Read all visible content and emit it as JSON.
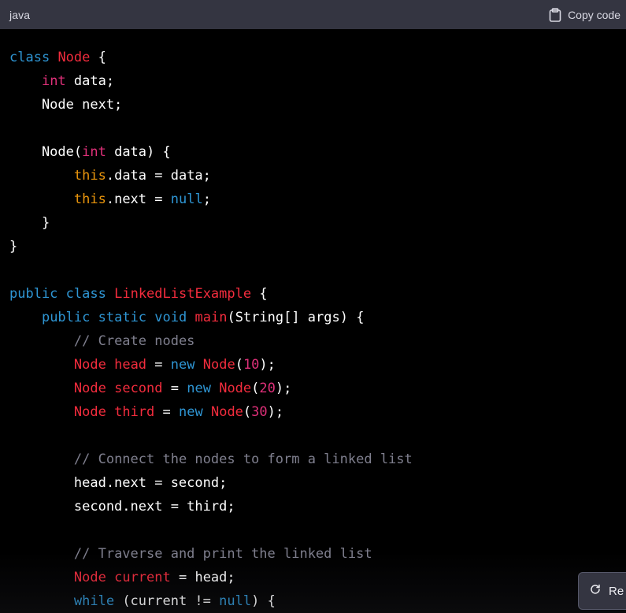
{
  "header": {
    "language": "java",
    "copy_label": "Copy code"
  },
  "code_lines": [
    [
      [
        "class",
        "kw"
      ],
      [
        " ",
        "txt"
      ],
      [
        "Node",
        "cls"
      ],
      [
        " {",
        "txt"
      ]
    ],
    [
      [
        "    ",
        "txt"
      ],
      [
        "int",
        "type"
      ],
      [
        " data;",
        "txt"
      ]
    ],
    [
      [
        "    Node next;",
        "txt"
      ]
    ],
    [
      [
        "",
        "txt"
      ]
    ],
    [
      [
        "    Node(",
        "txt"
      ],
      [
        "int",
        "type"
      ],
      [
        " data) {",
        "txt"
      ]
    ],
    [
      [
        "        ",
        "txt"
      ],
      [
        "this",
        "this"
      ],
      [
        ".data = data;",
        "txt"
      ]
    ],
    [
      [
        "        ",
        "txt"
      ],
      [
        "this",
        "this"
      ],
      [
        ".next = ",
        "txt"
      ],
      [
        "null",
        "lit"
      ],
      [
        ";",
        "txt"
      ]
    ],
    [
      [
        "    }",
        "txt"
      ]
    ],
    [
      [
        "}",
        "txt"
      ]
    ],
    [
      [
        "",
        "txt"
      ]
    ],
    [
      [
        "public",
        "kw"
      ],
      [
        " ",
        "txt"
      ],
      [
        "class",
        "kw"
      ],
      [
        " ",
        "txt"
      ],
      [
        "LinkedListExample",
        "cls"
      ],
      [
        " {",
        "txt"
      ]
    ],
    [
      [
        "    ",
        "txt"
      ],
      [
        "public",
        "kw"
      ],
      [
        " ",
        "txt"
      ],
      [
        "static",
        "kw"
      ],
      [
        " ",
        "txt"
      ],
      [
        "void",
        "kw"
      ],
      [
        " ",
        "txt"
      ],
      [
        "main",
        "fn"
      ],
      [
        "(String[] args) {",
        "txt"
      ]
    ],
    [
      [
        "        ",
        "txt"
      ],
      [
        "// Create nodes",
        "cm"
      ]
    ],
    [
      [
        "        ",
        "txt"
      ],
      [
        "Node",
        "cls"
      ],
      [
        " ",
        "txt"
      ],
      [
        "head",
        "cls"
      ],
      [
        " = ",
        "txt"
      ],
      [
        "new",
        "kw"
      ],
      [
        " ",
        "txt"
      ],
      [
        "Node",
        "cls"
      ],
      [
        "(",
        "txt"
      ],
      [
        "10",
        "num"
      ],
      [
        ");",
        "txt"
      ]
    ],
    [
      [
        "        ",
        "txt"
      ],
      [
        "Node",
        "cls"
      ],
      [
        " ",
        "txt"
      ],
      [
        "second",
        "cls"
      ],
      [
        " = ",
        "txt"
      ],
      [
        "new",
        "kw"
      ],
      [
        " ",
        "txt"
      ],
      [
        "Node",
        "cls"
      ],
      [
        "(",
        "txt"
      ],
      [
        "20",
        "num"
      ],
      [
        ");",
        "txt"
      ]
    ],
    [
      [
        "        ",
        "txt"
      ],
      [
        "Node",
        "cls"
      ],
      [
        " ",
        "txt"
      ],
      [
        "third",
        "cls"
      ],
      [
        " = ",
        "txt"
      ],
      [
        "new",
        "kw"
      ],
      [
        " ",
        "txt"
      ],
      [
        "Node",
        "cls"
      ],
      [
        "(",
        "txt"
      ],
      [
        "30",
        "num"
      ],
      [
        ");",
        "txt"
      ]
    ],
    [
      [
        "",
        "txt"
      ]
    ],
    [
      [
        "        ",
        "txt"
      ],
      [
        "// Connect the nodes to form a linked list",
        "cm"
      ]
    ],
    [
      [
        "        head.next = second;",
        "txt"
      ]
    ],
    [
      [
        "        second.next = third;",
        "txt"
      ]
    ],
    [
      [
        "",
        "txt"
      ]
    ],
    [
      [
        "        ",
        "txt"
      ],
      [
        "// Traverse and print the linked list",
        "cm"
      ]
    ],
    [
      [
        "        ",
        "txt"
      ],
      [
        "Node",
        "cls"
      ],
      [
        " ",
        "txt"
      ],
      [
        "current",
        "cls"
      ],
      [
        " = head;",
        "txt"
      ]
    ],
    [
      [
        "        ",
        "txt"
      ],
      [
        "while",
        "kw"
      ],
      [
        " (current != ",
        "txt"
      ],
      [
        "null",
        "lit"
      ],
      [
        ") {",
        "txt"
      ]
    ]
  ],
  "regenerate": {
    "label": "Re"
  },
  "colors": {
    "header_bg": "#343541",
    "code_bg": "#000000",
    "keyword": "#2e95d3",
    "class_name": "#f22c3d",
    "type": "#df3079",
    "this": "#e9950c",
    "comment": "#7f7f8e"
  }
}
